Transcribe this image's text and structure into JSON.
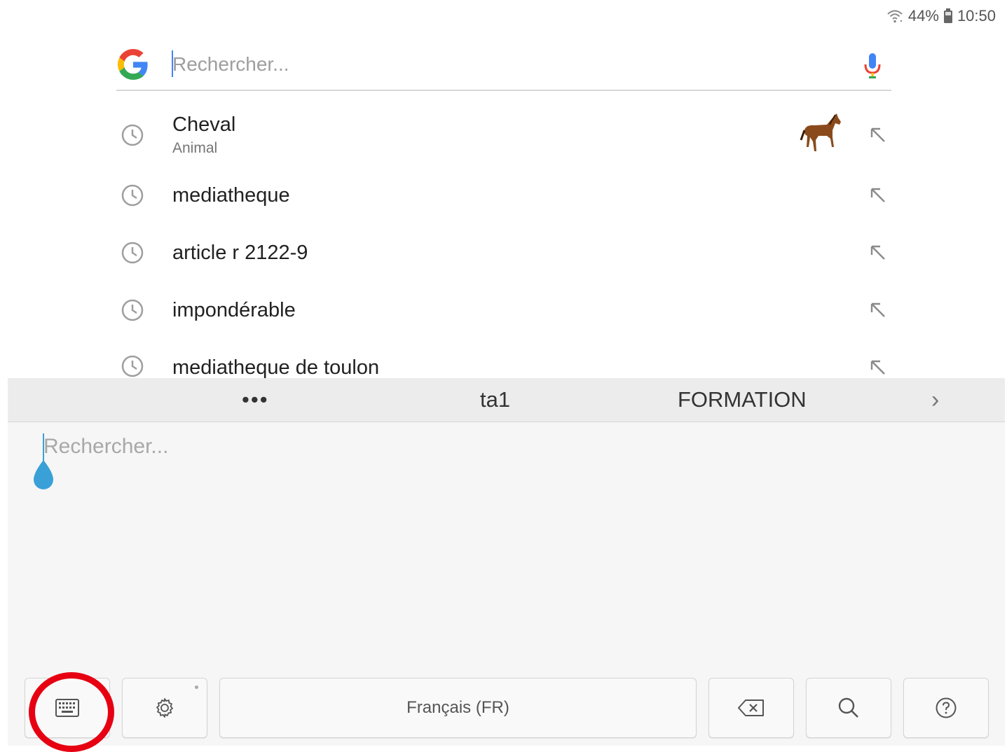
{
  "status_bar": {
    "battery": "44%",
    "time": "10:50"
  },
  "search": {
    "placeholder": "Rechercher...",
    "value": ""
  },
  "suggestions": [
    {
      "title": "Cheval",
      "subtitle": "Animal"
    },
    {
      "title": "mediatheque"
    },
    {
      "title": "article r 2122-9"
    },
    {
      "title": "impondérable"
    },
    {
      "title": "mediatheque de toulon"
    }
  ],
  "keyboard": {
    "predictions": {
      "more": "•••",
      "word1": "ta1",
      "word2": "FORMATION",
      "next": "›"
    },
    "handwriting_placeholder": "Rechercher...",
    "language_key": "Français (FR)"
  },
  "colors": {
    "google_blue": "#4285f4",
    "google_red": "#ea4335",
    "google_yellow": "#fbbc05",
    "google_green": "#34a853",
    "cursor_handle": "#3aa0d8",
    "highlight_ring": "#e60012"
  },
  "icons": {
    "suggestion_leading": "clock-history-icon",
    "suggestion_trailing": "insert-arrow-icon",
    "voice": "microphone-icon"
  }
}
